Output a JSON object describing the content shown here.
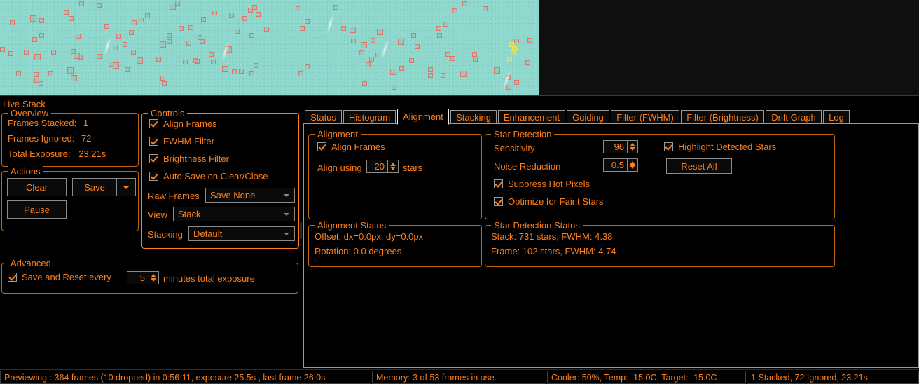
{
  "preview": {
    "label": "live-stack-preview",
    "background_color": "#8fd9ce",
    "detection_box_color": "#e0756b",
    "bright_star_color": "#f0e04a"
  },
  "left_panel": {
    "title": "Live Stack",
    "overview": {
      "title": "Overview",
      "rows": [
        {
          "label": "Frames Stacked:",
          "value": "1"
        },
        {
          "label": "Frames Ignored:",
          "value": "72"
        },
        {
          "label": "Total Exposure:",
          "value": "23.21s"
        }
      ]
    },
    "actions": {
      "title": "Actions",
      "clear_label": "Clear",
      "save_label": "Save",
      "save_dropdown_icon": "chevron-down-icon",
      "pause_label": "Pause"
    },
    "advanced": {
      "title": "Advanced",
      "save_reset_label": "Save and Reset every",
      "save_reset_checked": true,
      "minutes_value": "5",
      "suffix_label": "minutes total exposure"
    },
    "controls": {
      "title": "Controls",
      "checkboxes": [
        {
          "label": "Align Frames",
          "checked": true
        },
        {
          "label": "FWHM Filter",
          "checked": true
        },
        {
          "label": "Brightness Filter",
          "checked": true
        },
        {
          "label": "Auto Save on Clear/Close",
          "checked": true
        }
      ],
      "raw_frames_label": "Raw Frames",
      "raw_frames_value": "Save None",
      "view_label": "View",
      "view_value": "Stack",
      "stacking_label": "Stacking",
      "stacking_value": "Default"
    }
  },
  "tabs": {
    "items": [
      {
        "label": "Status",
        "active": false
      },
      {
        "label": "Histogram",
        "active": false
      },
      {
        "label": "Alignment",
        "active": true
      },
      {
        "label": "Stacking",
        "active": false
      },
      {
        "label": "Enhancement",
        "active": false
      },
      {
        "label": "Guiding",
        "active": false
      },
      {
        "label": "Filter (FWHM)",
        "active": false
      },
      {
        "label": "Filter (Brightness)",
        "active": false
      },
      {
        "label": "Drift Graph",
        "active": false
      },
      {
        "label": "Log",
        "active": false
      }
    ]
  },
  "alignment_tab": {
    "alignment": {
      "title": "Alignment",
      "align_frames_label": "Align Frames",
      "align_frames_checked": true,
      "align_using_label": "Align using",
      "align_using_value": "20",
      "stars_label": "stars"
    },
    "star_detection": {
      "title": "Star Detection",
      "sensitivity_label": "Sensitivity",
      "sensitivity_value": "96",
      "noise_reduction_label": "Noise Reduction",
      "noise_reduction_value": "0.5",
      "suppress_hot_pixels_label": "Suppress Hot Pixels",
      "suppress_hot_pixels_checked": true,
      "optimize_faint_stars_label": "Optimize for Faint Stars",
      "optimize_faint_stars_checked": true,
      "highlight_detected_stars_label": "Highlight Detected Stars",
      "highlight_detected_stars_checked": true,
      "reset_all_label": "Reset All"
    },
    "alignment_status": {
      "title": "Alignment Status",
      "offset": "Offset: dx=0.0px, dy=0.0px",
      "rotation": "Rotation: 0.0 degrees"
    },
    "star_detection_status": {
      "title": "Star Detection Status",
      "stack": "Stack:   731  stars, FWHM: 4.38",
      "frame": "Frame:  102  stars, FWHM: 4.74"
    }
  },
  "status_bar": {
    "preview": "Previewing : 364 frames (10 dropped) in 0:56:11, exposure 25.5s , last frame 26.0s",
    "memory": "Memory: 3 of 53 frames in use.",
    "cooler": "Cooler: 50%, Temp: -15.0C, Target: -15.0C",
    "stack": "1 Stacked, 72 Ignored, 23.21s"
  },
  "theme": {
    "accent": "#ff7f1a",
    "group_border": "#c06a10",
    "control_border": "#8a8a8a"
  }
}
